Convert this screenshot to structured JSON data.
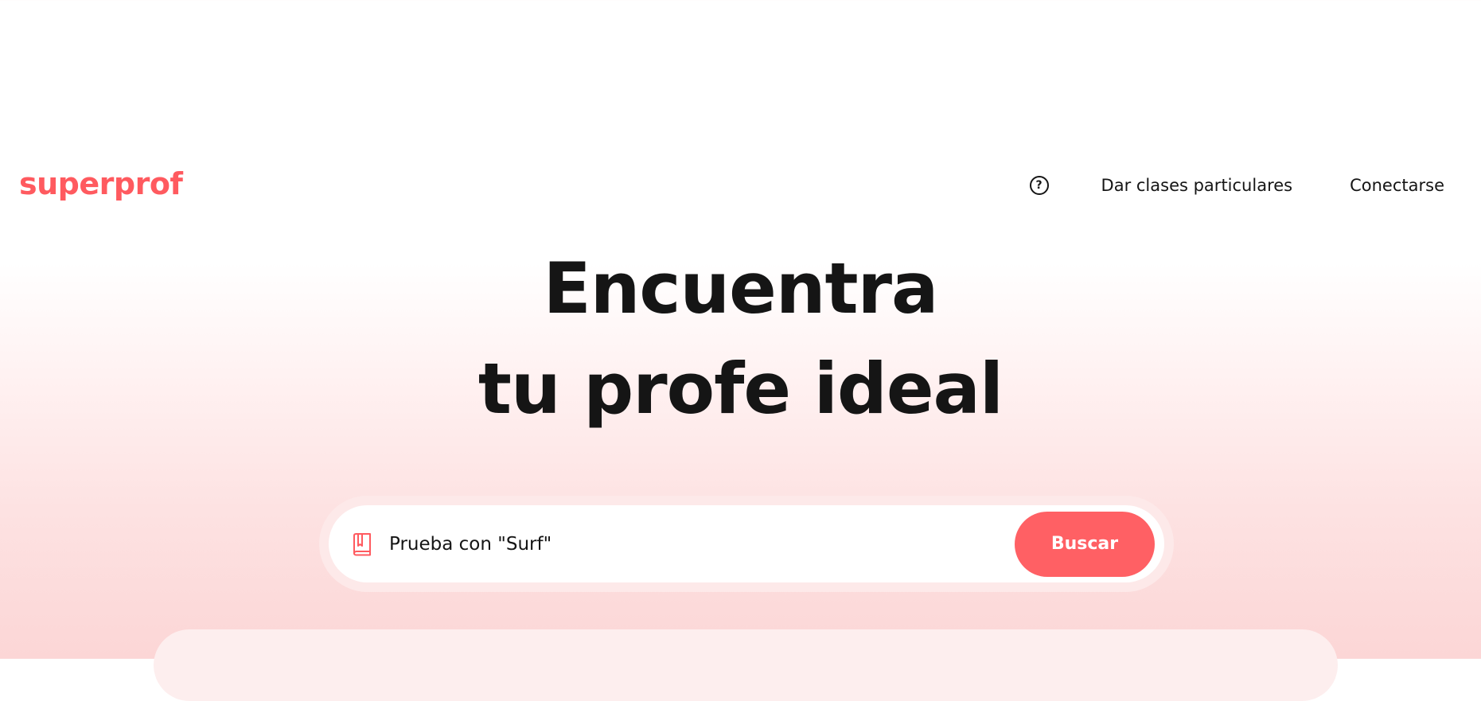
{
  "header": {
    "logo_text": "superprof",
    "help_icon": "question-circle-icon",
    "help_glyph": "?",
    "nav": {
      "teach_label": "Dar clases particulares",
      "login_label": "Conectarse"
    }
  },
  "hero": {
    "title_line1": "Encuentra",
    "title_line2": "tu profe ideal"
  },
  "search": {
    "icon": "book-icon",
    "placeholder": "Prueba con \"Surf\"",
    "button_label": "Buscar"
  },
  "colors": {
    "brand": "#ff5a5f",
    "button": "#ff6064",
    "text": "#151515",
    "background_gradient_end": "#fcd6d6"
  }
}
